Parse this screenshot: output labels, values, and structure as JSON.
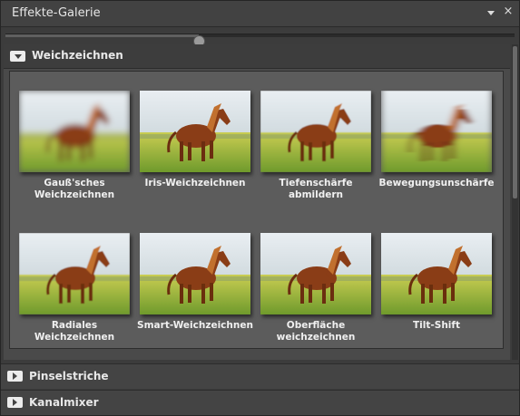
{
  "window": {
    "title": "Effekte-Galerie",
    "menu_icon": "dropdown-triangle-icon",
    "close_glyph": "×"
  },
  "zoom_slider": {
    "value": 0.38
  },
  "categories": [
    {
      "label": "Weichzeichnen",
      "expanded": true,
      "effects": [
        {
          "label": "Gauß'sches Weichzeichnen",
          "blur": 3.5
        },
        {
          "label": "Iris-Weichzeichnen",
          "blur": 0
        },
        {
          "label": "Tiefenschärfe abmildern",
          "blur": 0.6
        },
        {
          "label": "Bewegungsunschärfe",
          "blur": 0,
          "motion": true
        },
        {
          "label": "Radiales Weichzeichnen",
          "blur": 0.4
        },
        {
          "label": "Smart-Weichzeichnen",
          "blur": 0.3
        },
        {
          "label": "Oberfläche weichzeichnen",
          "blur": 0
        },
        {
          "label": "Tilt-Shift",
          "blur": 0.3
        }
      ]
    },
    {
      "label": "Pinselstriche",
      "expanded": false
    },
    {
      "label": "Kanalmixer",
      "expanded": false
    }
  ],
  "colors": {
    "sky": "#e9eef2",
    "field": "#b9c43a",
    "horse": "#8a3d17",
    "mane": "#c1702f"
  }
}
